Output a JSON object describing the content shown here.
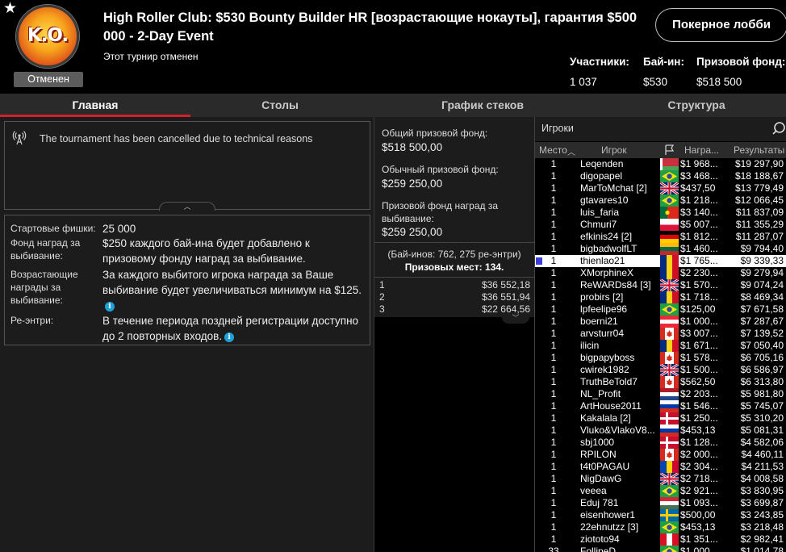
{
  "header": {
    "logo_text": "K.O.",
    "status_badge": "Отменен",
    "title": "High Roller Club: $530 Bounty Builder HR [возрастающие нокауты], гарантия $500 000 - 2-Day Event",
    "subtitle": "Этот турнир отменен",
    "lobby_button": "Покерное лобби",
    "stats": [
      {
        "label": "Участники:",
        "value": "1 037"
      },
      {
        "label": "Бай-ин:",
        "value": "$530"
      },
      {
        "label": "Призовой фонд:",
        "value": "$518 500"
      }
    ]
  },
  "tabs": [
    "Главная",
    "Столы",
    "График стеков",
    "Структура"
  ],
  "notice": {
    "message": "The tournament has been cancelled due to technical reasons"
  },
  "info": [
    {
      "label": "Стартовые фишки:",
      "value": "25 000",
      "info_icon": false
    },
    {
      "label": "Фонд наград за выбивание:",
      "value": "$250 каждого бай-ина будет добавлено к призовому фонду наград за выбивание.",
      "info_icon": false
    },
    {
      "label": "Возрастающие награды за выбивание:",
      "value": "За каждого выбитого игрока награда за Ваше выбивание будет увеличиваться минимум на $125.",
      "info_icon": true
    },
    {
      "label": "Ре-энтри:",
      "value": "В течение периода поздней регистрации доступно до 2 повторных входов.",
      "info_icon": true
    }
  ],
  "prize": {
    "total_label": "Общий призовой фонд:",
    "total_value": "$518 500,00",
    "regular_label": "Обычный призовой фонд:",
    "regular_value": "$259 250,00",
    "bounty_label": "Призовой фонд наград за выбивание:",
    "bounty_value": "$259 250,00",
    "buyins_text": "(Бай-инов: 762, 275 ре-энтри)",
    "paid_places": "Призовых мест: 134."
  },
  "payouts": [
    {
      "place": "1",
      "amount": "$36 552,18"
    },
    {
      "place": "2",
      "amount": "$36 551,94"
    },
    {
      "place": "3",
      "amount": "$22 664,56"
    }
  ],
  "players": {
    "title": "Игроки",
    "columns": {
      "place": "Место",
      "player": "Игрок",
      "bounty": "Награ...",
      "results": "Результаты"
    },
    "rows": [
      {
        "place": "1",
        "name": "Leqenden",
        "flag": "by",
        "bounty": "$1 968...",
        "result": "$19 297,90"
      },
      {
        "place": "1",
        "name": "digopapel",
        "flag": "br",
        "bounty": "$3 468...",
        "result": "$18 188,67"
      },
      {
        "place": "1",
        "name": "MarToMchat [2]",
        "flag": "gb",
        "bounty": "$437,50",
        "result": "$13 779,49"
      },
      {
        "place": "1",
        "name": "gtavares10",
        "flag": "br",
        "bounty": "$1 218...",
        "result": "$12 066,45"
      },
      {
        "place": "1",
        "name": "luis_faria",
        "flag": "pt",
        "bounty": "$3 140...",
        "result": "$11 837,09"
      },
      {
        "place": "1",
        "name": "Chmuri7",
        "flag": "pl",
        "bounty": "$5 007...",
        "result": "$11 355,29"
      },
      {
        "place": "1",
        "name": "efkinis24 [2]",
        "flag": "de",
        "bounty": "$1 812...",
        "result": "$11 287,07"
      },
      {
        "place": "1",
        "name": "bigbadwolfLT",
        "flag": "lt",
        "bounty": "$1 460...",
        "result": "$9 794,40"
      },
      {
        "place": "1",
        "name": "thienlao21",
        "flag": "ro",
        "bounty": "$1 765...",
        "result": "$9 339,33",
        "highlight": true
      },
      {
        "place": "1",
        "name": "XMorphineX",
        "flag": "ro",
        "bounty": "$2 230...",
        "result": "$9 279,94"
      },
      {
        "place": "1",
        "name": "ReWARDs84 [3]",
        "flag": "gb",
        "bounty": "$1 570...",
        "result": "$9 074,24"
      },
      {
        "place": "1",
        "name": "probirs [2]",
        "flag": "ro",
        "bounty": "$1 718...",
        "result": "$8 469,34"
      },
      {
        "place": "1",
        "name": "lpfeelipe96",
        "flag": "br",
        "bounty": "$125,00",
        "result": "$7 671,58"
      },
      {
        "place": "1",
        "name": "boerni21",
        "flag": "at",
        "bounty": "$1 000...",
        "result": "$7 287,67"
      },
      {
        "place": "1",
        "name": "arvsturr04",
        "flag": "ca",
        "bounty": "$3 007...",
        "result": "$7 139,52"
      },
      {
        "place": "1",
        "name": "ilicin",
        "flag": "ro",
        "bounty": "$1 671...",
        "result": "$7 050,40"
      },
      {
        "place": "1",
        "name": "bigpapyboss",
        "flag": "ca",
        "bounty": "$1 578...",
        "result": "$6 705,16"
      },
      {
        "place": "1",
        "name": "cwirek1982",
        "flag": "gb",
        "bounty": "$1 500...",
        "result": "$6 586,97"
      },
      {
        "place": "1",
        "name": "TruthBeTold7",
        "flag": "ca",
        "bounty": "$562,50",
        "result": "$6 313,80"
      },
      {
        "place": "1",
        "name": "NL_Profit",
        "flag": "nl",
        "bounty": "$2 203...",
        "result": "$5 981,80"
      },
      {
        "place": "1",
        "name": "ArtHouse2011",
        "flag": "ru",
        "bounty": "$1 546...",
        "result": "$5 745,07"
      },
      {
        "place": "1",
        "name": "Kakalala [2]",
        "flag": "dk",
        "bounty": "$1 250...",
        "result": "$5 310,20"
      },
      {
        "place": "1",
        "name": "Vluko&VlakoV8...",
        "flag": "ru",
        "bounty": "$453,13",
        "result": "$5 081,31"
      },
      {
        "place": "1",
        "name": "sbj1000",
        "flag": "dk",
        "bounty": "$1 128...",
        "result": "$4 582,06"
      },
      {
        "place": "1",
        "name": "RPILON",
        "flag": "ca",
        "bounty": "$2 000...",
        "result": "$4 460,11"
      },
      {
        "place": "1",
        "name": "t4t0PAGAU",
        "flag": "md",
        "bounty": "$2 304...",
        "result": "$4 211,53"
      },
      {
        "place": "1",
        "name": "NigDawG",
        "flag": "gb",
        "bounty": "$2 718...",
        "result": "$4 008,58"
      },
      {
        "place": "1",
        "name": "veeea",
        "flag": "br",
        "bounty": "$2 921...",
        "result": "$3 830,95"
      },
      {
        "place": "1",
        "name": "Eduj 781",
        "flag": "hu",
        "bounty": "$1 093...",
        "result": "$3 699,87"
      },
      {
        "place": "1",
        "name": "eisenhower1",
        "flag": "se",
        "bounty": "$500,00",
        "result": "$3 243,85"
      },
      {
        "place": "1",
        "name": "22ehnutzz [3]",
        "flag": "br",
        "bounty": "$453,13",
        "result": "$3 218,48"
      },
      {
        "place": "1",
        "name": "ziototo94",
        "flag": "pe",
        "bounty": "$1 351...",
        "result": "$2 982,41"
      },
      {
        "place": "33",
        "name": "FollipeD",
        "flag": "br",
        "bounty": "$1 000",
        "result": "$1 014,78"
      }
    ]
  },
  "colors": {
    "accent": "#d3202f",
    "panel": "#1c1c1c",
    "info": "#1ea0d8",
    "marker": "#3d3dd8"
  }
}
